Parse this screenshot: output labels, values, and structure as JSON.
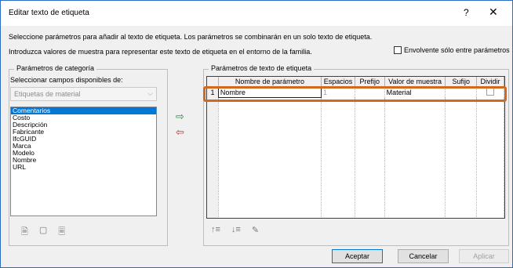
{
  "window": {
    "title": "Editar texto de etiqueta",
    "help": "?",
    "close": "✕"
  },
  "intro": {
    "line1": "Seleccione parámetros para añadir al texto de etiqueta. Los parámetros se combinarán en un solo texto de etiqueta.",
    "line2": "Introduzca valores de muestra para representar este texto de etiqueta en el entorno de la familia."
  },
  "wrap_checkbox": {
    "label": "Envolvente sólo entre parámetros",
    "checked": false
  },
  "category_group": {
    "title": "Parámetros de categoría",
    "select_label": "Seleccionar campos disponibles de:",
    "combo_value": "Etiquetas de material",
    "items": [
      "Comentarios",
      "Costo",
      "Descripción",
      "Fabricante",
      "IfcGUID",
      "Marca",
      "Modelo",
      "Nombre",
      "URL"
    ],
    "selected_index": 0
  },
  "label_group": {
    "title": "Parámetros de texto de etiqueta",
    "columns": [
      "Nombre de parámetro",
      "Espacios",
      "Prefijo",
      "Valor de muestra",
      "Sufijo",
      "Dividir"
    ],
    "rows": [
      {
        "num": "1",
        "name": "Nombre",
        "spaces": "1",
        "prefix": "",
        "sample": "Material",
        "suffix": "",
        "divide": false
      }
    ]
  },
  "icons": {
    "add_right": "arrow-right-icon",
    "remove_left": "arrow-left-icon",
    "new_param": "new-parameter-icon",
    "edit_param": "edit-parameter-icon",
    "add_param": "add-parameter-icon",
    "move_up": "move-up-icon",
    "move_down": "move-down-icon",
    "format": "format-icon"
  },
  "buttons": {
    "ok": "Aceptar",
    "cancel": "Cancelar",
    "apply": "Aplicar"
  },
  "colors": {
    "accent": "#0078d7",
    "highlight": "#d2691e"
  }
}
